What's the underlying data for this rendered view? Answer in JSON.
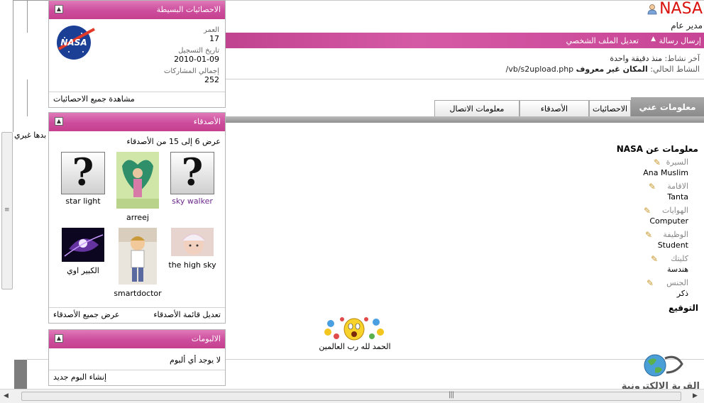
{
  "user": {
    "name": "NASA",
    "title": "مدير عام",
    "icon": "user-online-icon"
  },
  "actions": {
    "send_message": "إرسال رسالة",
    "edit_profile": "تعديل الملف الشخصي"
  },
  "activity": {
    "last_label": "آخر نشاط:",
    "last_value": "منذ دقيقة واحدة",
    "current_label": "النشاط الحالي:",
    "current_value": "المكان غير معروف",
    "current_path": "vb/s2upload.php/"
  },
  "tabs": {
    "about": "معلومات عني",
    "stats": "الاحصائيات",
    "friends": "الأصدقاء",
    "contact": "معلومات الاتصال"
  },
  "about": {
    "heading": "معلومات عن NASA",
    "fields": [
      {
        "label": "السيرة",
        "value": "Ana Muslim"
      },
      {
        "label": "الاقامة",
        "value": "Tanta"
      },
      {
        "label": "الهوايات",
        "value": "Computer"
      },
      {
        "label": "الوظيفة",
        "value": "Student"
      },
      {
        "label": "كليتك",
        "value": "هندسة"
      },
      {
        "label": "الجنس",
        "value": "ذكر"
      }
    ],
    "signature_heading": "التوقيع",
    "signature_text": "الحمد لله رب العالمين"
  },
  "partial_text": "بدها غيري",
  "logo_text": "القرية الالكترونية",
  "stats_block": {
    "title": "الاحصائيات البسيطة",
    "age_label": "العمر",
    "age_value": "17",
    "join_label": "تاريخ التسجيل",
    "join_value": "2010-01-09",
    "posts_label": "إجمالي المشاركات",
    "posts_value": "252",
    "footer": "مشاهدة جميع الاحصائيات"
  },
  "friends_block": {
    "title": "الأصدقاء",
    "range": "عرض 6 إلى 15 من الأصدقاء",
    "friends": [
      {
        "name": "sky walker",
        "color": "#6b2a8c"
      },
      {
        "name": "arreej",
        "color": "#000000"
      },
      {
        "name": "star light",
        "color": "#000000"
      },
      {
        "name": "the high sky",
        "color": "#000000"
      },
      {
        "name": "smartdoctor",
        "color": "#000000"
      },
      {
        "name": "الكبير اوي",
        "color": "#000000"
      }
    ],
    "edit_list": "تعديل قائمة الأصدقاء",
    "view_all": "عرض جميع الأصدقاء"
  },
  "albums_block": {
    "title": "الالبومات",
    "empty": "لا يوجد أي ألبوم",
    "create": "إنشاء البوم جديد"
  },
  "colors": {
    "pink": "#cc4c9c",
    "username_red": "#d9120d",
    "tab_active": "#9a9a9a"
  }
}
